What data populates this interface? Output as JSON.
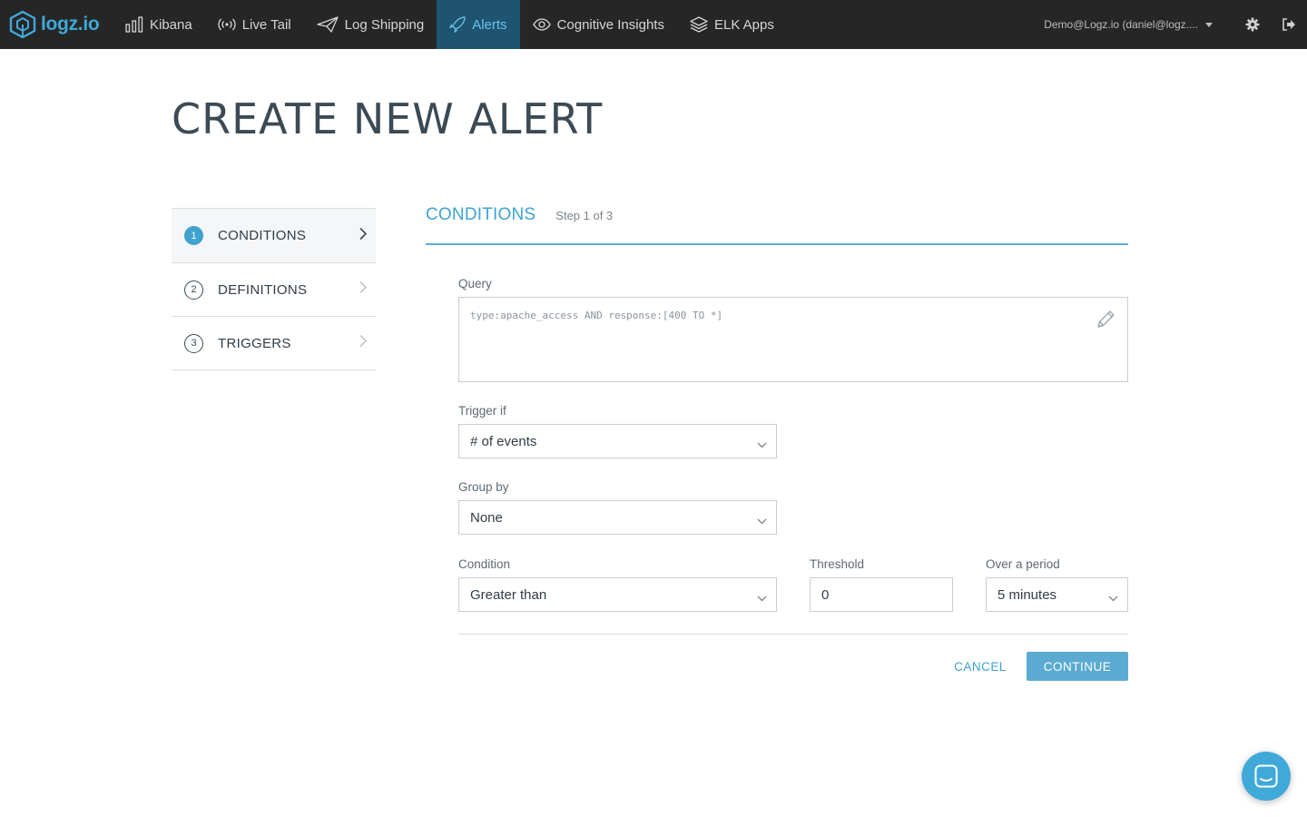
{
  "brand": {
    "name": "logz.io",
    "accent": "#3fa9d9"
  },
  "nav": {
    "items": [
      {
        "label": "Kibana",
        "icon": "bar-chart-icon"
      },
      {
        "label": "Live Tail",
        "icon": "broadcast-icon"
      },
      {
        "label": "Log Shipping",
        "icon": "paper-plane-icon"
      },
      {
        "label": "Alerts",
        "icon": "rocket-icon",
        "active": true
      },
      {
        "label": "Cognitive Insights",
        "icon": "eye-icon"
      },
      {
        "label": "ELK Apps",
        "icon": "layers-icon"
      }
    ],
    "user": "Demo@Logz.io (daniel@logz...."
  },
  "page": {
    "title": "CREATE NEW ALERT"
  },
  "steps": [
    {
      "num": "1",
      "label": "CONDITIONS",
      "active": true
    },
    {
      "num": "2",
      "label": "DEFINITIONS"
    },
    {
      "num": "3",
      "label": "TRIGGERS"
    }
  ],
  "section": {
    "title": "CONDITIONS",
    "step": "Step 1 of 3"
  },
  "form": {
    "query_label": "Query",
    "query_value": "type:apache_access AND response:[400 TO *]",
    "trigger_label": "Trigger if",
    "trigger_value": "# of events",
    "group_label": "Group by",
    "group_value": "None",
    "condition_label": "Condition",
    "condition_value": "Greater than",
    "threshold_label": "Threshold",
    "threshold_value": "0",
    "period_label": "Over a period",
    "period_value": "5 minutes"
  },
  "actions": {
    "cancel": "CANCEL",
    "continue": "CONTINUE"
  }
}
